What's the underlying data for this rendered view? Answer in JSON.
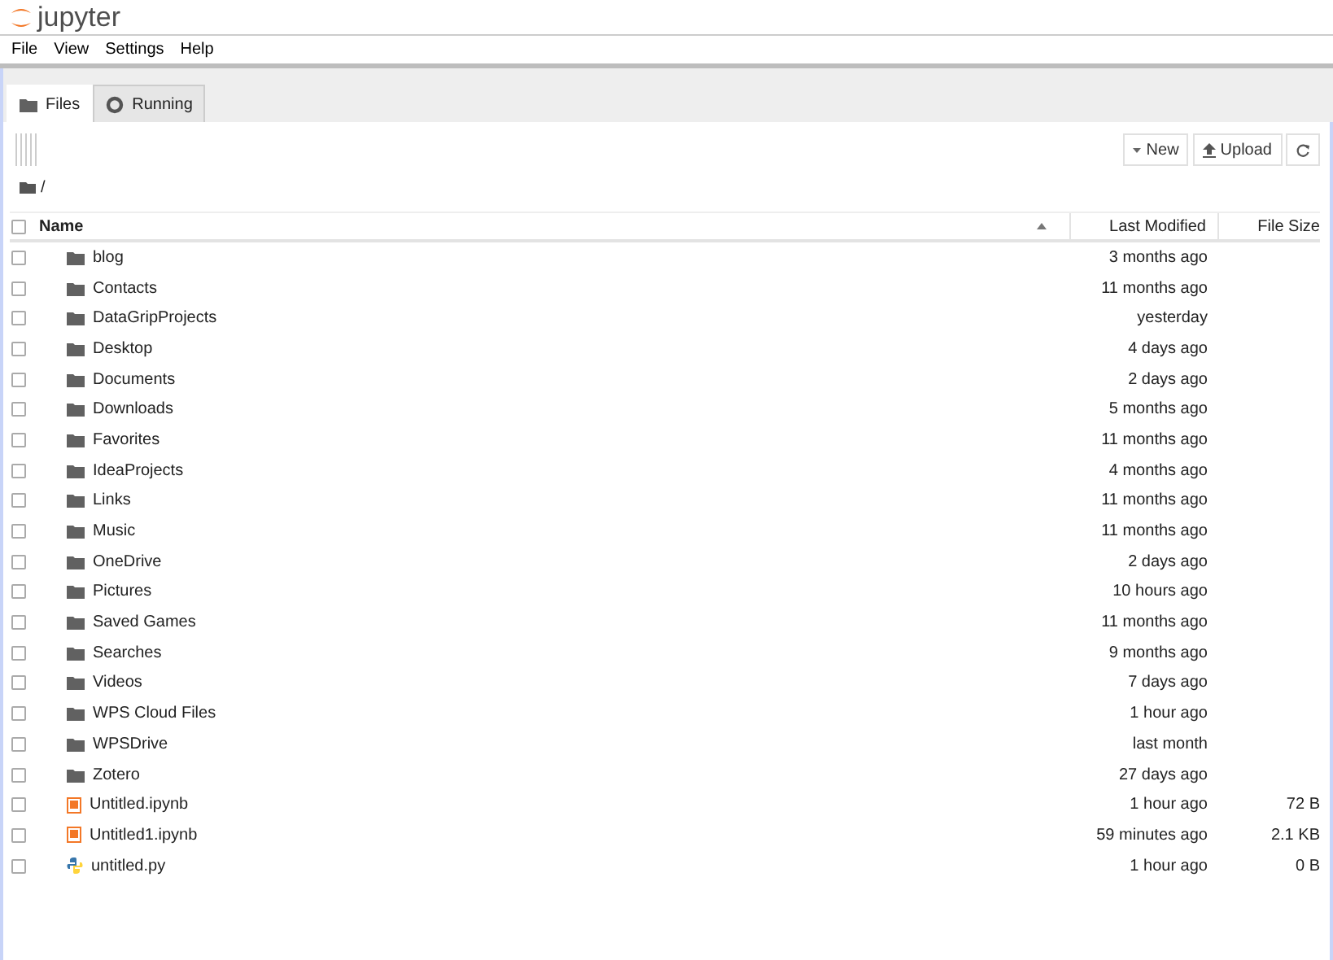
{
  "header": {
    "logo": "jupyter"
  },
  "menu": [
    "File",
    "View",
    "Settings",
    "Help"
  ],
  "tabs": [
    {
      "label": "Files",
      "kind": "folder",
      "selected": true
    },
    {
      "label": "Running",
      "kind": "running",
      "selected": false
    }
  ],
  "toolbar": {
    "buttons": [
      {
        "label": "New",
        "kind": "new"
      },
      {
        "label": "Upload",
        "kind": "upload"
      },
      {
        "kind": "refresh"
      }
    ]
  },
  "breadcrumb": "/",
  "table": {
    "select_all_checked": false,
    "columns": [
      {
        "label": "Name",
        "sorted": true
      },
      {
        "label": "Last Modified",
        "sorted": false
      },
      {
        "label": "File Size",
        "sorted": false
      }
    ],
    "rows": [
      {
        "name": "blog",
        "kind": "folder",
        "modified": "3 months ago",
        "checked": false
      },
      {
        "name": "Contacts",
        "kind": "folder",
        "modified": "11 months ago",
        "checked": false
      },
      {
        "name": "DataGripProjects",
        "kind": "folder",
        "modified": "yesterday",
        "checked": false
      },
      {
        "name": "Desktop",
        "kind": "folder",
        "modified": "4 days ago",
        "checked": false
      },
      {
        "name": "Documents",
        "kind": "folder",
        "modified": "2 days ago",
        "checked": false
      },
      {
        "name": "Downloads",
        "kind": "folder",
        "modified": "5 months ago",
        "checked": false
      },
      {
        "name": "Favorites",
        "kind": "folder",
        "modified": "11 months ago",
        "checked": false
      },
      {
        "name": "IdeaProjects",
        "kind": "folder",
        "modified": "4 months ago",
        "checked": false
      },
      {
        "name": "Links",
        "kind": "folder",
        "modified": "11 months ago",
        "checked": false
      },
      {
        "name": "Music",
        "kind": "folder",
        "modified": "11 months ago",
        "checked": false
      },
      {
        "name": "OneDrive",
        "kind": "folder",
        "modified": "2 days ago",
        "checked": false
      },
      {
        "name": "Pictures",
        "kind": "folder",
        "modified": "10 hours ago",
        "checked": false
      },
      {
        "name": "Saved Games",
        "kind": "folder",
        "modified": "11 months ago",
        "checked": false
      },
      {
        "name": "Searches",
        "kind": "folder",
        "modified": "9 months ago",
        "checked": false
      },
      {
        "name": "Videos",
        "kind": "folder",
        "modified": "7 days ago",
        "checked": false
      },
      {
        "name": "WPS Cloud Files",
        "kind": "folder",
        "modified": "1 hour ago",
        "checked": false
      },
      {
        "name": "WPSDrive",
        "kind": "folder",
        "modified": "last month",
        "checked": false
      },
      {
        "name": "Zotero",
        "kind": "folder",
        "modified": "27 days ago",
        "checked": false
      },
      {
        "name": "Untitled.ipynb",
        "kind": "notebook",
        "modified": "1 hour ago",
        "size": "72 B",
        "checked": false
      },
      {
        "name": "Untitled1.ipynb",
        "kind": "notebook",
        "modified": "59 minutes ago",
        "size": "2.1 KB",
        "checked": false
      },
      {
        "name": "untitled.py",
        "kind": "python",
        "modified": "1 hour ago",
        "size": "0 B",
        "checked": false
      }
    ]
  }
}
